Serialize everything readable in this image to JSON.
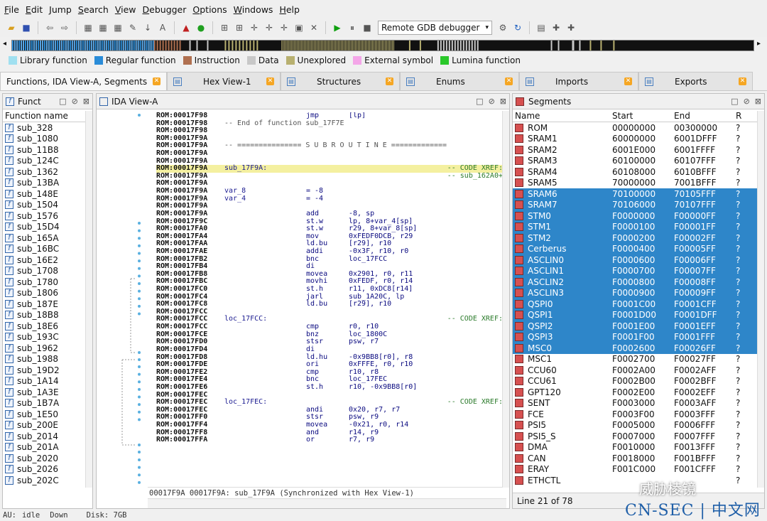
{
  "menu": [
    "File",
    "Edit",
    "Jump",
    "Search",
    "View",
    "Debugger",
    "Options",
    "Windows",
    "Help"
  ],
  "toolbar": {
    "debugger_select": "Remote GDB debugger"
  },
  "legend": [
    {
      "label": "Library function",
      "color": "#a0e0f0"
    },
    {
      "label": "Regular function",
      "color": "#2a8cd8"
    },
    {
      "label": "Instruction",
      "color": "#b07050"
    },
    {
      "label": "Data",
      "color": "#c8c8c8"
    },
    {
      "label": "Unexplored",
      "color": "#b8b070"
    },
    {
      "label": "External symbol",
      "color": "#f4a6e8"
    },
    {
      "label": "Lumina function",
      "color": "#2ac82a"
    }
  ],
  "tabs": [
    {
      "label": "Functions, IDA View-A, Segments",
      "active": true
    },
    {
      "label": "Hex View-1"
    },
    {
      "label": "Structures"
    },
    {
      "label": "Enums"
    },
    {
      "label": "Imports"
    },
    {
      "label": "Exports"
    }
  ],
  "functions": {
    "title": "Funct",
    "column": "Function name",
    "items": [
      "sub_328",
      "sub_1080",
      "sub_11B8",
      "sub_124C",
      "sub_1362",
      "sub_13BA",
      "sub_148E",
      "sub_1504",
      "sub_1576",
      "sub_15D4",
      "sub_165A",
      "sub_16BC",
      "sub_16E2",
      "sub_1708",
      "sub_1780",
      "sub_1806",
      "sub_187E",
      "sub_18B8",
      "sub_18E6",
      "sub_193C",
      "sub_1962",
      "sub_1988",
      "sub_19D2",
      "sub_1A14",
      "sub_1A3E",
      "sub_1B7A",
      "sub_1E50",
      "sub_200E",
      "sub_2014",
      "sub_201A",
      "sub_2020",
      "sub_2026",
      "sub_202C"
    ]
  },
  "ida_view": {
    "title": "IDA View-A",
    "status": "00017F9A 00017F9A: sub_17F9A (Synchronized with Hex View-1)",
    "lines": [
      {
        "a": "ROM:00017F98",
        "l": "",
        "m": "jmp",
        "o": "[lp]",
        "c": ""
      },
      {
        "a": "ROM:00017F98",
        "l": "-- End of function sub_17F7E",
        "m": "",
        "o": "",
        "c": ""
      },
      {
        "a": "ROM:00017F98",
        "l": "",
        "m": "",
        "o": "",
        "c": ""
      },
      {
        "a": "ROM:00017F9A",
        "l": "",
        "m": "",
        "o": "",
        "c": ""
      },
      {
        "a": "ROM:00017F9A",
        "l": "-- =============== S U B R O U T I N E =============",
        "m": "",
        "o": "",
        "c": ""
      },
      {
        "a": "ROM:00017F9A",
        "l": "",
        "m": "",
        "o": "",
        "c": ""
      },
      {
        "a": "ROM:00017F9A",
        "l": "",
        "m": "",
        "o": "",
        "c": ""
      },
      {
        "a": "ROM:00017F9A",
        "l": "sub_17F9A:",
        "m": "",
        "o": "",
        "c": "-- CODE XREF:",
        "hl": true
      },
      {
        "a": "ROM:00017F9A",
        "l": "",
        "m": "",
        "o": "",
        "c": "-- sub_162A0+"
      },
      {
        "a": "ROM:00017F9A",
        "l": "",
        "m": "",
        "o": "",
        "c": ""
      },
      {
        "a": "ROM:00017F9A",
        "l": "var_8",
        "m": "= -8",
        "o": "",
        "c": ""
      },
      {
        "a": "ROM:00017F9A",
        "l": "var_4",
        "m": "= -4",
        "o": "",
        "c": ""
      },
      {
        "a": "ROM:00017F9A",
        "l": "",
        "m": "",
        "o": "",
        "c": ""
      },
      {
        "a": "ROM:00017F9A",
        "l": "",
        "m": "add",
        "o": "-8, sp",
        "c": ""
      },
      {
        "a": "ROM:00017F9C",
        "l": "",
        "m": "st.w",
        "o": "lp, 8+var_4[sp]",
        "c": ""
      },
      {
        "a": "ROM:00017FA0",
        "l": "",
        "m": "st.w",
        "o": "r29, 8+var_8[sp]",
        "c": ""
      },
      {
        "a": "ROM:00017FA4",
        "l": "",
        "m": "mov",
        "o": "0xFEDF0DCB, r29",
        "c": ""
      },
      {
        "a": "ROM:00017FAA",
        "l": "",
        "m": "ld.bu",
        "o": "[r29], r10",
        "c": ""
      },
      {
        "a": "ROM:00017FAE",
        "l": "",
        "m": "addi",
        "o": "-0x3F, r10, r0",
        "c": ""
      },
      {
        "a": "ROM:00017FB2",
        "l": "",
        "m": "bnc",
        "o": "loc_17FCC",
        "c": ""
      },
      {
        "a": "ROM:00017FB4",
        "l": "",
        "m": "di",
        "o": "",
        "c": ""
      },
      {
        "a": "ROM:00017FB8",
        "l": "",
        "m": "movea",
        "o": "0x2901, r0, r11",
        "c": ""
      },
      {
        "a": "ROM:00017FBC",
        "l": "",
        "m": "movhi",
        "o": "0xFEDF, r0, r14",
        "c": ""
      },
      {
        "a": "ROM:00017FC0",
        "l": "",
        "m": "st.h",
        "o": "r11, 0xDC8[r14]",
        "c": ""
      },
      {
        "a": "ROM:00017FC4",
        "l": "",
        "m": "jarl",
        "o": "sub_1A20C, lp",
        "c": ""
      },
      {
        "a": "ROM:00017FC8",
        "l": "",
        "m": "ld.bu",
        "o": "[r29], r10",
        "c": ""
      },
      {
        "a": "ROM:00017FCC",
        "l": "",
        "m": "",
        "o": "",
        "c": ""
      },
      {
        "a": "ROM:00017FCC",
        "l": "loc_17FCC:",
        "m": "",
        "o": "",
        "c": "-- CODE XREF:"
      },
      {
        "a": "ROM:00017FCC",
        "l": "",
        "m": "cmp",
        "o": "r0, r10",
        "c": ""
      },
      {
        "a": "ROM:00017FCE",
        "l": "",
        "m": "bnz",
        "o": "loc_1800C",
        "c": ""
      },
      {
        "a": "ROM:00017FD0",
        "l": "",
        "m": "stsr",
        "o": "psw, r7",
        "c": ""
      },
      {
        "a": "ROM:00017FD4",
        "l": "",
        "m": "di",
        "o": "",
        "c": ""
      },
      {
        "a": "ROM:00017FD8",
        "l": "",
        "m": "ld.hu",
        "o": "-0x9BB8[r0], r8",
        "c": ""
      },
      {
        "a": "ROM:00017FDE",
        "l": "",
        "m": "ori",
        "o": "0xFFFE, r0, r10",
        "c": ""
      },
      {
        "a": "ROM:00017FE2",
        "l": "",
        "m": "cmp",
        "o": "r10, r8",
        "c": ""
      },
      {
        "a": "ROM:00017FE4",
        "l": "",
        "m": "bnc",
        "o": "loc_17FEC",
        "c": ""
      },
      {
        "a": "ROM:00017FE6",
        "l": "",
        "m": "st.h",
        "o": "r10, -0x9BB8[r0]",
        "c": ""
      },
      {
        "a": "ROM:00017FEC",
        "l": "",
        "m": "",
        "o": "",
        "c": ""
      },
      {
        "a": "ROM:00017FEC",
        "l": "loc_17FEC:",
        "m": "",
        "o": "",
        "c": "-- CODE XREF:"
      },
      {
        "a": "ROM:00017FEC",
        "l": "",
        "m": "andi",
        "o": "0x20, r7, r7",
        "c": ""
      },
      {
        "a": "ROM:00017FF0",
        "l": "",
        "m": "stsr",
        "o": "psw, r9",
        "c": ""
      },
      {
        "a": "ROM:00017FF4",
        "l": "",
        "m": "movea",
        "o": "-0x21, r0, r14",
        "c": ""
      },
      {
        "a": "ROM:00017FF8",
        "l": "",
        "m": "and",
        "o": "r14, r9",
        "c": ""
      },
      {
        "a": "ROM:00017FFA",
        "l": "",
        "m": "or",
        "o": "r7, r9",
        "c": ""
      }
    ]
  },
  "segments": {
    "title": "Segments",
    "columns": [
      "Name",
      "Start",
      "End",
      "R"
    ],
    "status": "Line 21 of 78",
    "rows": [
      {
        "n": "ROM",
        "s": "00000000",
        "e": "00300000",
        "r": "?"
      },
      {
        "n": "SRAM1",
        "s": "60000000",
        "e": "6001DFFF",
        "r": "?"
      },
      {
        "n": "SRAM2",
        "s": "6001E000",
        "e": "6001FFFF",
        "r": "?"
      },
      {
        "n": "SRAM3",
        "s": "60100000",
        "e": "60107FFF",
        "r": "?"
      },
      {
        "n": "SRAM4",
        "s": "60108000",
        "e": "6010BFFF",
        "r": "?"
      },
      {
        "n": "SRAM5",
        "s": "70000000",
        "e": "7001BFFF",
        "r": "?"
      },
      {
        "n": "SRAM6",
        "s": "70100000",
        "e": "70105FFF",
        "r": "?",
        "sel": true
      },
      {
        "n": "SRAM7",
        "s": "70106000",
        "e": "70107FFF",
        "r": "?",
        "sel": true
      },
      {
        "n": "STM0",
        "s": "F0000000",
        "e": "F00000FF",
        "r": "?",
        "sel": true
      },
      {
        "n": "STM1",
        "s": "F0000100",
        "e": "F00001FF",
        "r": "?",
        "sel": true
      },
      {
        "n": "STM2",
        "s": "F0000200",
        "e": "F00002FF",
        "r": "?",
        "sel": true
      },
      {
        "n": "Cerberus",
        "s": "F0000400",
        "e": "F00005FF",
        "r": "?",
        "sel": true
      },
      {
        "n": "ASCLIN0",
        "s": "F0000600",
        "e": "F00006FF",
        "r": "?",
        "sel": true
      },
      {
        "n": "ASCLIN1",
        "s": "F0000700",
        "e": "F00007FF",
        "r": "?",
        "sel": true
      },
      {
        "n": "ASCLIN2",
        "s": "F0000800",
        "e": "F00008FF",
        "r": "?",
        "sel": true
      },
      {
        "n": "ASCLIN3",
        "s": "F0000900",
        "e": "F00009FF",
        "r": "?",
        "sel": true
      },
      {
        "n": "QSPI0",
        "s": "F0001C00",
        "e": "F0001CFF",
        "r": "?",
        "sel": true
      },
      {
        "n": "QSPI1",
        "s": "F0001D00",
        "e": "F0001DFF",
        "r": "?",
        "sel": true
      },
      {
        "n": "QSPI2",
        "s": "F0001E00",
        "e": "F0001EFF",
        "r": "?",
        "sel": true
      },
      {
        "n": "QSPI3",
        "s": "F0001F00",
        "e": "F0001FFF",
        "r": "?",
        "sel": true
      },
      {
        "n": "MSC0",
        "s": "F0002600",
        "e": "F00026FF",
        "r": "?",
        "sel": true
      },
      {
        "n": "MSC1",
        "s": "F0002700",
        "e": "F00027FF",
        "r": "?"
      },
      {
        "n": "CCU60",
        "s": "F0002A00",
        "e": "F0002AFF",
        "r": "?"
      },
      {
        "n": "CCU61",
        "s": "F0002B00",
        "e": "F0002BFF",
        "r": "?"
      },
      {
        "n": "GPT120",
        "s": "F0002E00",
        "e": "F0002EFF",
        "r": "?"
      },
      {
        "n": "SENT",
        "s": "F0003000",
        "e": "F0003AFF",
        "r": "?"
      },
      {
        "n": "FCE",
        "s": "F0003F00",
        "e": "F0003FFF",
        "r": "?"
      },
      {
        "n": "PSI5",
        "s": "F0005000",
        "e": "F0006FFF",
        "r": "?"
      },
      {
        "n": "PSI5_S",
        "s": "F0007000",
        "e": "F0007FFF",
        "r": "?"
      },
      {
        "n": "DMA",
        "s": "F0010000",
        "e": "F0013FFF",
        "r": "?"
      },
      {
        "n": "CAN",
        "s": "F0018000",
        "e": "F001BFFF",
        "r": "?"
      },
      {
        "n": "ERAY",
        "s": "F001C000",
        "e": "F001CFFF",
        "r": "?"
      },
      {
        "n": "ETHCTL",
        "s": "",
        "e": "",
        "r": "?"
      }
    ]
  },
  "statusbar": {
    "au": "AU:",
    "state": "idle",
    "dir": "Down",
    "disk": "Disk: 7GB"
  },
  "watermark": {
    "line1": "威胁棱镜",
    "line2": "CN-SEC | 中文网"
  }
}
